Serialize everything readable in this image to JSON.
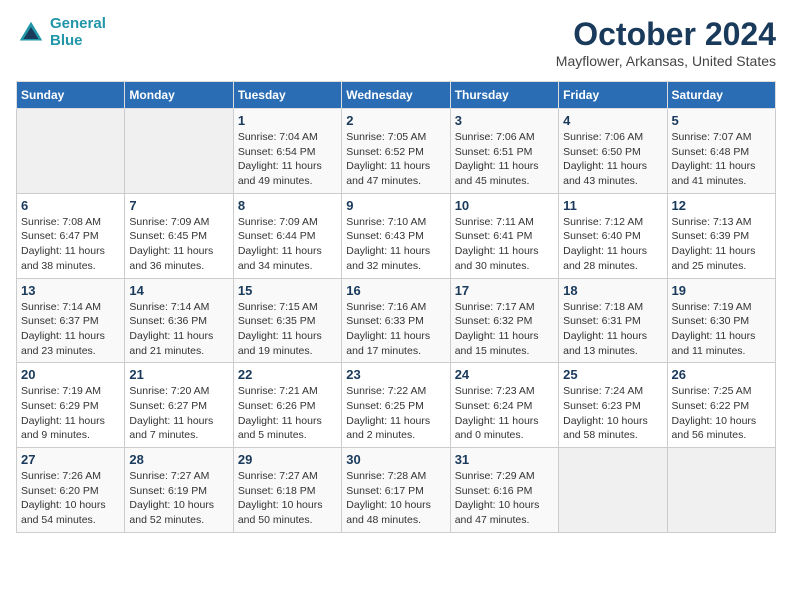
{
  "header": {
    "logo_line1": "General",
    "logo_line2": "Blue",
    "month_title": "October 2024",
    "location": "Mayflower, Arkansas, United States"
  },
  "days_of_week": [
    "Sunday",
    "Monday",
    "Tuesday",
    "Wednesday",
    "Thursday",
    "Friday",
    "Saturday"
  ],
  "weeks": [
    [
      {
        "day": "",
        "info": ""
      },
      {
        "day": "",
        "info": ""
      },
      {
        "day": "1",
        "info": "Sunrise: 7:04 AM\nSunset: 6:54 PM\nDaylight: 11 hours and 49 minutes."
      },
      {
        "day": "2",
        "info": "Sunrise: 7:05 AM\nSunset: 6:52 PM\nDaylight: 11 hours and 47 minutes."
      },
      {
        "day": "3",
        "info": "Sunrise: 7:06 AM\nSunset: 6:51 PM\nDaylight: 11 hours and 45 minutes."
      },
      {
        "day": "4",
        "info": "Sunrise: 7:06 AM\nSunset: 6:50 PM\nDaylight: 11 hours and 43 minutes."
      },
      {
        "day": "5",
        "info": "Sunrise: 7:07 AM\nSunset: 6:48 PM\nDaylight: 11 hours and 41 minutes."
      }
    ],
    [
      {
        "day": "6",
        "info": "Sunrise: 7:08 AM\nSunset: 6:47 PM\nDaylight: 11 hours and 38 minutes."
      },
      {
        "day": "7",
        "info": "Sunrise: 7:09 AM\nSunset: 6:45 PM\nDaylight: 11 hours and 36 minutes."
      },
      {
        "day": "8",
        "info": "Sunrise: 7:09 AM\nSunset: 6:44 PM\nDaylight: 11 hours and 34 minutes."
      },
      {
        "day": "9",
        "info": "Sunrise: 7:10 AM\nSunset: 6:43 PM\nDaylight: 11 hours and 32 minutes."
      },
      {
        "day": "10",
        "info": "Sunrise: 7:11 AM\nSunset: 6:41 PM\nDaylight: 11 hours and 30 minutes."
      },
      {
        "day": "11",
        "info": "Sunrise: 7:12 AM\nSunset: 6:40 PM\nDaylight: 11 hours and 28 minutes."
      },
      {
        "day": "12",
        "info": "Sunrise: 7:13 AM\nSunset: 6:39 PM\nDaylight: 11 hours and 25 minutes."
      }
    ],
    [
      {
        "day": "13",
        "info": "Sunrise: 7:14 AM\nSunset: 6:37 PM\nDaylight: 11 hours and 23 minutes."
      },
      {
        "day": "14",
        "info": "Sunrise: 7:14 AM\nSunset: 6:36 PM\nDaylight: 11 hours and 21 minutes."
      },
      {
        "day": "15",
        "info": "Sunrise: 7:15 AM\nSunset: 6:35 PM\nDaylight: 11 hours and 19 minutes."
      },
      {
        "day": "16",
        "info": "Sunrise: 7:16 AM\nSunset: 6:33 PM\nDaylight: 11 hours and 17 minutes."
      },
      {
        "day": "17",
        "info": "Sunrise: 7:17 AM\nSunset: 6:32 PM\nDaylight: 11 hours and 15 minutes."
      },
      {
        "day": "18",
        "info": "Sunrise: 7:18 AM\nSunset: 6:31 PM\nDaylight: 11 hours and 13 minutes."
      },
      {
        "day": "19",
        "info": "Sunrise: 7:19 AM\nSunset: 6:30 PM\nDaylight: 11 hours and 11 minutes."
      }
    ],
    [
      {
        "day": "20",
        "info": "Sunrise: 7:19 AM\nSunset: 6:29 PM\nDaylight: 11 hours and 9 minutes."
      },
      {
        "day": "21",
        "info": "Sunrise: 7:20 AM\nSunset: 6:27 PM\nDaylight: 11 hours and 7 minutes."
      },
      {
        "day": "22",
        "info": "Sunrise: 7:21 AM\nSunset: 6:26 PM\nDaylight: 11 hours and 5 minutes."
      },
      {
        "day": "23",
        "info": "Sunrise: 7:22 AM\nSunset: 6:25 PM\nDaylight: 11 hours and 2 minutes."
      },
      {
        "day": "24",
        "info": "Sunrise: 7:23 AM\nSunset: 6:24 PM\nDaylight: 11 hours and 0 minutes."
      },
      {
        "day": "25",
        "info": "Sunrise: 7:24 AM\nSunset: 6:23 PM\nDaylight: 10 hours and 58 minutes."
      },
      {
        "day": "26",
        "info": "Sunrise: 7:25 AM\nSunset: 6:22 PM\nDaylight: 10 hours and 56 minutes."
      }
    ],
    [
      {
        "day": "27",
        "info": "Sunrise: 7:26 AM\nSunset: 6:20 PM\nDaylight: 10 hours and 54 minutes."
      },
      {
        "day": "28",
        "info": "Sunrise: 7:27 AM\nSunset: 6:19 PM\nDaylight: 10 hours and 52 minutes."
      },
      {
        "day": "29",
        "info": "Sunrise: 7:27 AM\nSunset: 6:18 PM\nDaylight: 10 hours and 50 minutes."
      },
      {
        "day": "30",
        "info": "Sunrise: 7:28 AM\nSunset: 6:17 PM\nDaylight: 10 hours and 48 minutes."
      },
      {
        "day": "31",
        "info": "Sunrise: 7:29 AM\nSunset: 6:16 PM\nDaylight: 10 hours and 47 minutes."
      },
      {
        "day": "",
        "info": ""
      },
      {
        "day": "",
        "info": ""
      }
    ]
  ]
}
